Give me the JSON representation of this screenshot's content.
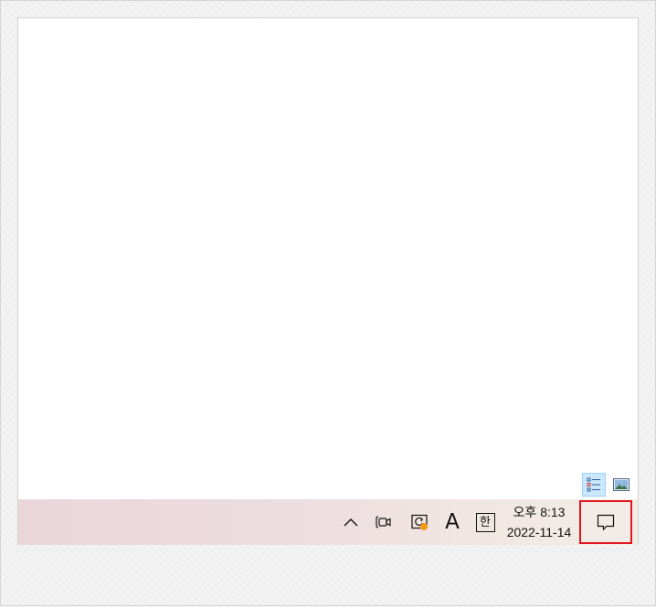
{
  "taskbar": {
    "clock": {
      "time": "오후 8:13",
      "date": "2022-11-14"
    },
    "tray": {
      "font_icon_text": "A",
      "ime_text": "한"
    }
  },
  "icons": {
    "chevron": "chevron-up-icon",
    "meet": "meet-now-icon",
    "update": "update-icon",
    "notification": "action-center-icon",
    "details_view": "details-view-icon",
    "preview_view": "preview-view-icon"
  },
  "colors": {
    "highlight": "#e0161e",
    "badge": "#f39c12",
    "view_active": "#cce8ff"
  }
}
